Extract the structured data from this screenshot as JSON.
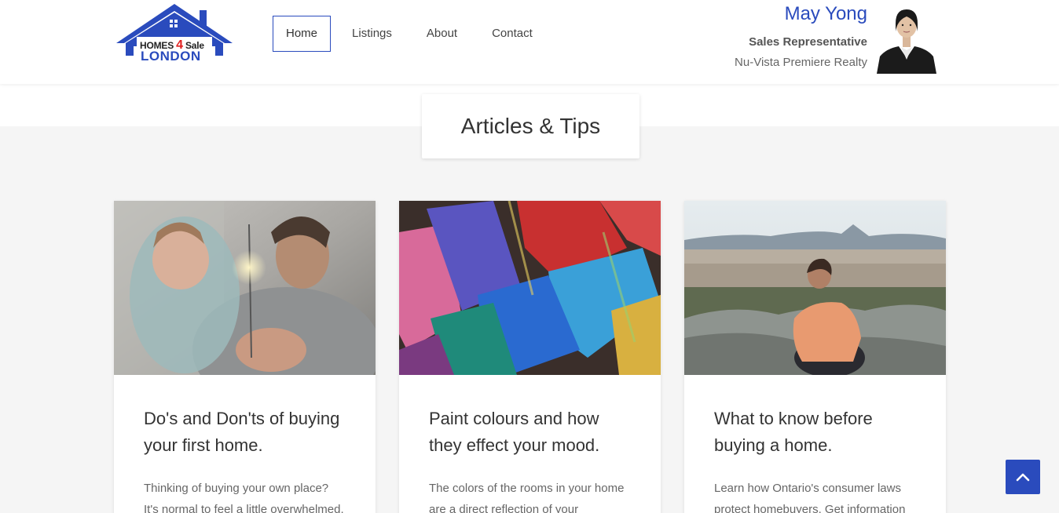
{
  "logo": {
    "line1_a": "HOMES",
    "line1_num": "4",
    "line1_b": "Sale",
    "line2": "LONDON"
  },
  "nav": {
    "items": [
      "Home",
      "Listings",
      "About",
      "Contact"
    ],
    "active": "Home"
  },
  "agent": {
    "name": "May Yong",
    "title": "Sales Representative",
    "company": "Nu-Vista Premiere Realty"
  },
  "section": {
    "title": "Articles & Tips"
  },
  "articles": [
    {
      "title": "Do's and Don'ts of buying your first home.",
      "excerpt": "Thinking of buying your own place? It's normal to feel a little overwhelmed."
    },
    {
      "title": "Paint colours and how they effect your mood.",
      "excerpt": "The colors of the rooms in your home are a direct reflection of your"
    },
    {
      "title": "What to know before buying a home.",
      "excerpt": "Learn how Ontario's consumer laws protect homebuyers. Get information"
    }
  ],
  "colors": {
    "brand_blue": "#2a4bbd",
    "logo_red": "#e02020",
    "page_bg": "#f5f5f5"
  },
  "icons": {
    "scroll_top": "chevron-up-icon"
  }
}
